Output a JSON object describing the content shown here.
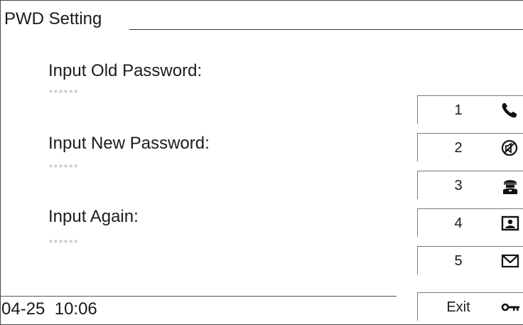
{
  "window": {
    "title": "PWD Setting"
  },
  "form": {
    "old_label": "Input Old Password:",
    "old_value": "******",
    "new_label": "Input New Password:",
    "new_value": "******",
    "again_label": "Input Again:",
    "again_value": "******"
  },
  "side_menu": {
    "items": [
      {
        "label": "1",
        "icon": "phone-icon"
      },
      {
        "label": "2",
        "icon": "mute-icon"
      },
      {
        "label": "3",
        "icon": "guard-icon"
      },
      {
        "label": "4",
        "icon": "photo-icon"
      },
      {
        "label": "5",
        "icon": "envelope-icon"
      },
      {
        "label": "Exit",
        "icon": "key-icon"
      }
    ]
  },
  "status": {
    "datetime": "04-25  10:06"
  }
}
